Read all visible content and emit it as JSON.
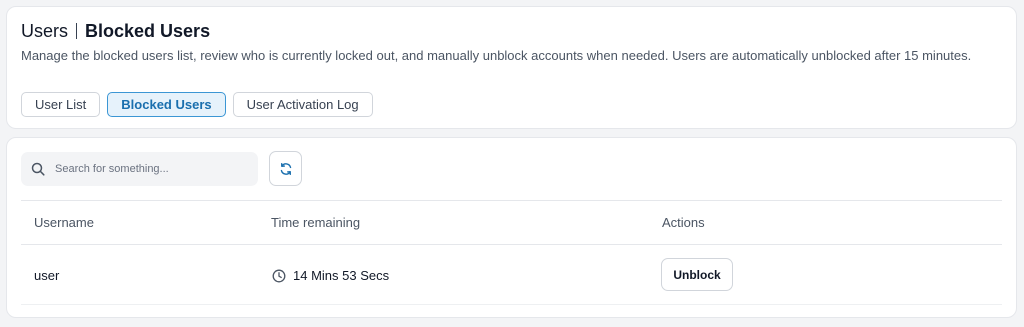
{
  "header": {
    "section": "Users",
    "page_title": "Blocked Users",
    "description": "Manage the blocked users list, review who is currently locked out, and manually unblock accounts when needed. Users are automatically unblocked after 15 minutes."
  },
  "tabs": [
    {
      "label": "User List",
      "active": false
    },
    {
      "label": "Blocked Users",
      "active": true
    },
    {
      "label": "User Activation Log",
      "active": false
    }
  ],
  "toolbar": {
    "search_placeholder": "Search for something...",
    "search_icon": "search-icon",
    "refresh_icon": "refresh-icon"
  },
  "table": {
    "columns": [
      "Username",
      "Time remaining",
      "Actions"
    ],
    "rows": [
      {
        "username": "user",
        "time_remaining": "14 Mins 53 Secs",
        "action_label": "Unblock"
      }
    ]
  },
  "colors": {
    "accent": "#1a6fae",
    "accent_bg": "#e6f2fb",
    "accent_border": "#3b96d4"
  }
}
